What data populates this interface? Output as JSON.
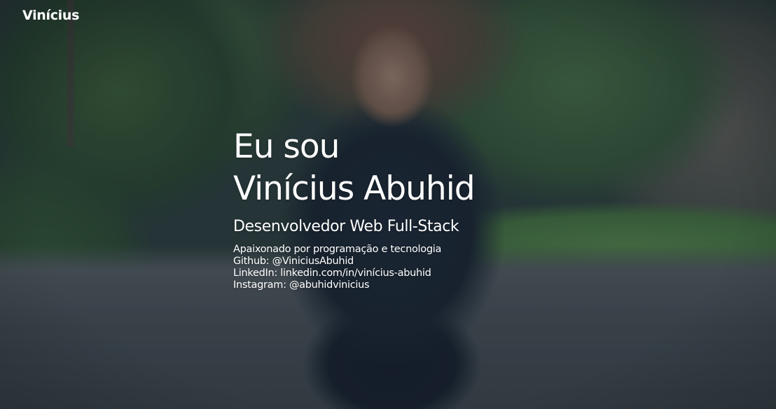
{
  "brand": {
    "name": "Vinícius"
  },
  "hero": {
    "greeting": "Eu sou",
    "name": "Vinícius Abuhid",
    "role": "Desenvolvedor Web Full-Stack",
    "details": [
      "Apaixonado por programação e tecnologia",
      "Github: @ViniciusAbuhid",
      "LinkedIn: linkedin.com/in/vinícius-abuhid",
      "Instagram: @abuhidvinicius"
    ]
  },
  "colors": {
    "text": "#ffffff",
    "overlay": "#14283780"
  }
}
